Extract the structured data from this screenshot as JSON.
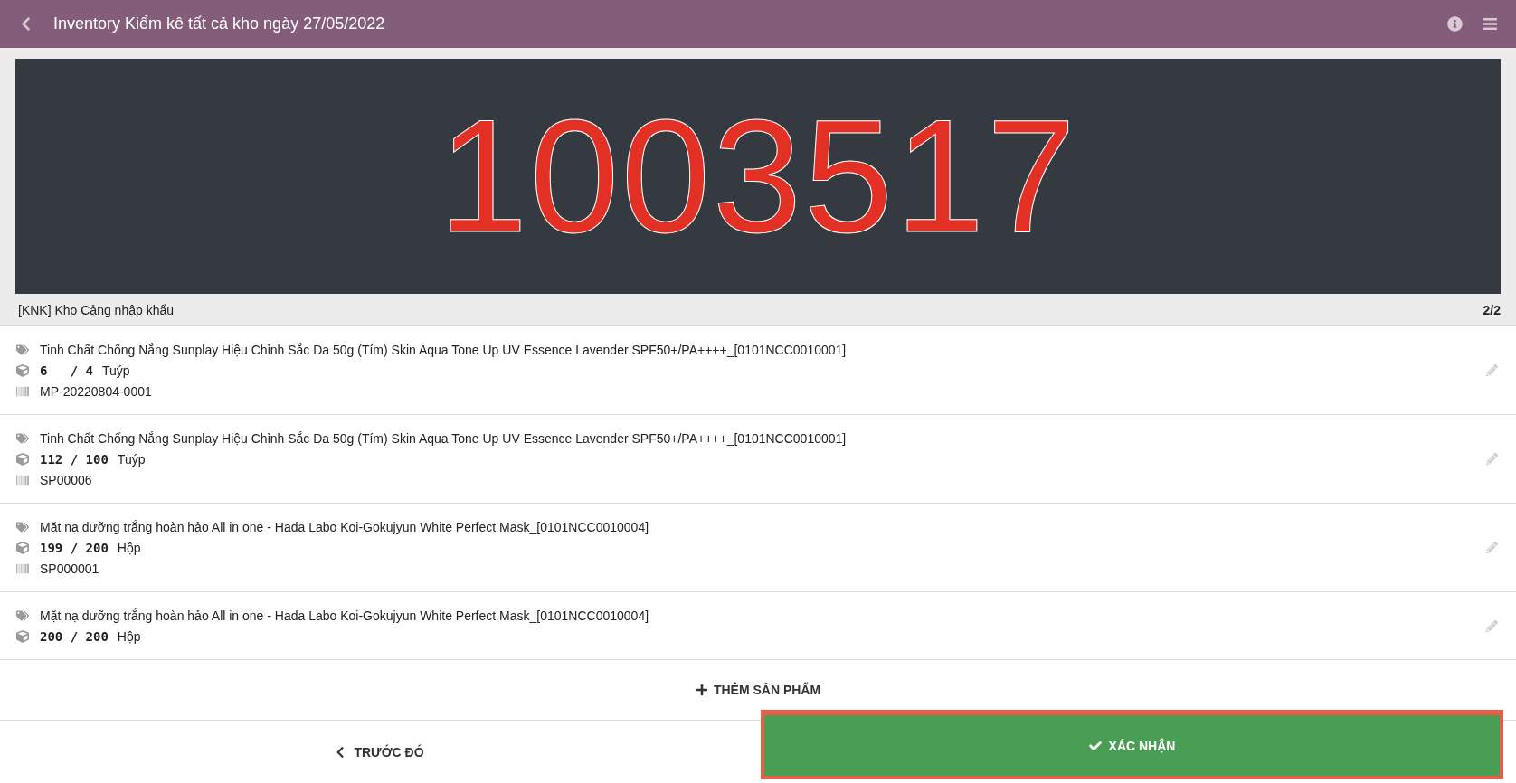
{
  "header": {
    "title": "Inventory Kiểm kê tất cả kho ngày 27/05/2022"
  },
  "display": {
    "code": "1003517"
  },
  "location": {
    "name": "[KNK] Kho Cảng nhập khẩu",
    "counter": "2/2"
  },
  "lines": [
    {
      "product": "Tinh Chất Chống Nắng Sunplay Hiệu Chỉnh Sắc Da 50g (Tím) Skin Aqua Tone Up UV Essence Lavender SPF50+/PA++++_[0101NCC0010001]",
      "qty": "6   / 4",
      "uom": "Tuýp",
      "barcode": "MP-20220804-0001"
    },
    {
      "product": "Tinh Chất Chống Nắng Sunplay Hiệu Chỉnh Sắc Da 50g (Tím) Skin Aqua Tone Up UV Essence Lavender SPF50+/PA++++_[0101NCC0010001]",
      "qty": "112 / 100",
      "uom": "Tuýp",
      "barcode": "SP00006"
    },
    {
      "product": "Mặt nạ dưỡng trắng hoàn hảo All in one - Hada Labo Koi-Gokujyun White Perfect Mask_[0101NCC0010004]",
      "qty": "199 / 200",
      "uom": "Hộp",
      "barcode": "SP000001"
    },
    {
      "product": "Mặt nạ dưỡng trắng hoàn hảo All in one - Hada Labo Koi-Gokujyun White Perfect Mask_[0101NCC0010004]",
      "qty": "200 / 200",
      "uom": "Hộp"
    }
  ],
  "add_button": "THÊM SẢN PHẨM",
  "footer": {
    "previous": "TRƯỚC ĐÓ",
    "confirm": "XÁC NHẬN"
  }
}
